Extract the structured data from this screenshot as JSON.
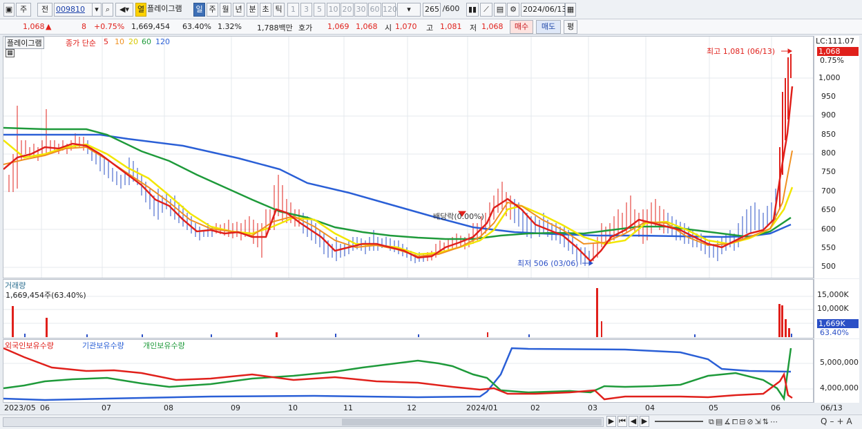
{
  "toolbar": {
    "mode": "주",
    "prev": "전",
    "code": "009810",
    "open_label": "열",
    "stock_name": "플레이그램",
    "periods": [
      "일",
      "주",
      "월",
      "년",
      "분",
      "초",
      "틱"
    ],
    "active_period": "일",
    "intervals": [
      "1",
      "3",
      "5",
      "10",
      "20",
      "30",
      "60",
      "120"
    ],
    "count": "265",
    "count_max": "/600",
    "date": "2024/06/13"
  },
  "quote": {
    "price": "1,068",
    "arrow": "▲",
    "change": "8",
    "change_pct": "+0.75%",
    "volume": "1,669,454",
    "vol_pct": "63.40%",
    "turnover": "1.32%",
    "amount": "1,788백만",
    "hoga_label": "호가",
    "hoga1": "1,069",
    "hoga2": "1,068",
    "open_label": "시",
    "open": "1,070",
    "high_label": "고",
    "high": "1,081",
    "low_label": "저",
    "low": "1,068",
    "buy": "매수",
    "sell": "매도",
    "flat": "평"
  },
  "price_panel": {
    "name": "플레이그램",
    "legend_prefix": "종가 단순",
    "ma": [
      {
        "label": "5",
        "color": "#e0201b"
      },
      {
        "label": "10",
        "color": "#f09020"
      },
      {
        "label": "20",
        "color": "#f2e600"
      },
      {
        "label": "60",
        "color": "#1e9a3a"
      },
      {
        "label": "120",
        "color": "#2a5fd6"
      }
    ],
    "lc": "LC:111.07",
    "last_tag": "1,068",
    "pct_tag": "0.75%",
    "high_note": "최고 1,081 (06/13)",
    "low_note": "최저 506 (03/06)",
    "dividend_note": "배당락(0.00%)",
    "yticks": [
      "1,000",
      "950",
      "900",
      "850",
      "800",
      "750",
      "700",
      "650",
      "600",
      "550",
      "500"
    ]
  },
  "volume_panel": {
    "title": "거래량",
    "value": "1,669,454주(63.40%)",
    "yticks": [
      "15,000K",
      "10,000K"
    ],
    "last_tag": "1,669K",
    "pct_tag": "63.40%"
  },
  "holding_panel": {
    "legend": [
      {
        "label": "외국인보유수량",
        "color": "#e0201b"
      },
      {
        "label": "기관보유수량",
        "color": "#2a5fd6"
      },
      {
        "label": "개인보유수량",
        "color": "#1e9a3a"
      }
    ],
    "yticks": [
      "5,000,000",
      "4,000,000"
    ]
  },
  "xaxis": {
    "labels": [
      "2023/05",
      "06",
      "07",
      "08",
      "09",
      "10",
      "11",
      "12",
      "2024/01",
      "02",
      "03",
      "04",
      "05",
      "06"
    ],
    "right_label": "06/13"
  },
  "chart_data": {
    "type": "line",
    "title": "플레이그램",
    "ylim": [
      480,
      1100
    ],
    "series_close": [
      760,
      800,
      830,
      810,
      830,
      820,
      790,
      730,
      700,
      690,
      660,
      640,
      600,
      590,
      610,
      620,
      590,
      600,
      650,
      640,
      590,
      560,
      550,
      540,
      530,
      520,
      560,
      600,
      650,
      680,
      620,
      580,
      560,
      560,
      590,
      620,
      640,
      620,
      600,
      600,
      640,
      1068
    ],
    "high": 1081,
    "low": 506
  }
}
